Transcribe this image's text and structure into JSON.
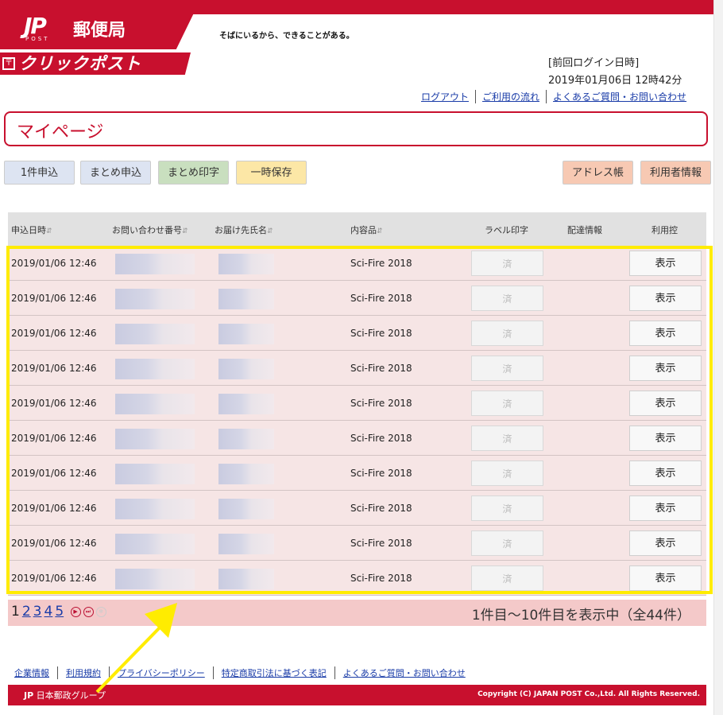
{
  "brand": {
    "mark": "JP",
    "post": "POST",
    "name": "郵便局",
    "tagline": "そばにいるから、できることがある。",
    "service": "クリックポスト"
  },
  "login": {
    "label": "[前回ログイン日時]",
    "datetime": "2019年01月06日 12時42分"
  },
  "top_links": [
    "ログアウト",
    "ご利用の流れ",
    "よくあるご質問・お問い合わせ"
  ],
  "page_title": "マイページ",
  "actions": {
    "single": "1件申込",
    "batch": "まとめ申込",
    "batch_print": "まとめ印字",
    "temp_save": "一時保存",
    "address_book": "アドレス帳",
    "user_info": "利用者情報"
  },
  "table": {
    "headers": {
      "date": "申込日時",
      "inquiry": "お問い合わせ番号",
      "recipient": "お届け先氏名",
      "contents": "内容品",
      "label": "ラベル印字",
      "delivery": "配達情報",
      "receipt": "利用控"
    },
    "rows": [
      {
        "date": "2019/01/06 12:46",
        "contents": "Sci-Fire 2018",
        "label": "済",
        "receipt": "表示"
      },
      {
        "date": "2019/01/06 12:46",
        "contents": "Sci-Fire 2018",
        "label": "済",
        "receipt": "表示"
      },
      {
        "date": "2019/01/06 12:46",
        "contents": "Sci-Fire 2018",
        "label": "済",
        "receipt": "表示"
      },
      {
        "date": "2019/01/06 12:46",
        "contents": "Sci-Fire 2018",
        "label": "済",
        "receipt": "表示"
      },
      {
        "date": "2019/01/06 12:46",
        "contents": "Sci-Fire 2018",
        "label": "済",
        "receipt": "表示"
      },
      {
        "date": "2019/01/06 12:46",
        "contents": "Sci-Fire 2018",
        "label": "済",
        "receipt": "表示"
      },
      {
        "date": "2019/01/06 12:46",
        "contents": "Sci-Fire 2018",
        "label": "済",
        "receipt": "表示"
      },
      {
        "date": "2019/01/06 12:46",
        "contents": "Sci-Fire 2018",
        "label": "済",
        "receipt": "表示"
      },
      {
        "date": "2019/01/06 12:46",
        "contents": "Sci-Fire 2018",
        "label": "済",
        "receipt": "表示"
      },
      {
        "date": "2019/01/06 12:46",
        "contents": "Sci-Fire 2018",
        "label": "済",
        "receipt": "表示"
      }
    ]
  },
  "pagination": {
    "current": "1",
    "pages": [
      "2",
      "3",
      "4",
      "5"
    ],
    "info": "1件目～10件目を表示中（全44件）"
  },
  "footer": {
    "links": [
      "企業情報",
      "利用規約",
      "プライバシーポリシー",
      "特定商取引法に基づく表記",
      "よくあるご質問・お問い合わせ"
    ],
    "group": "日本郵政グループ",
    "copyright": "Copyright (C) JAPAN POST Co.,Ltd. All Rights Reserved."
  },
  "colors": {
    "brand_red": "#c8102e",
    "highlight_yellow": "#ffec00"
  }
}
